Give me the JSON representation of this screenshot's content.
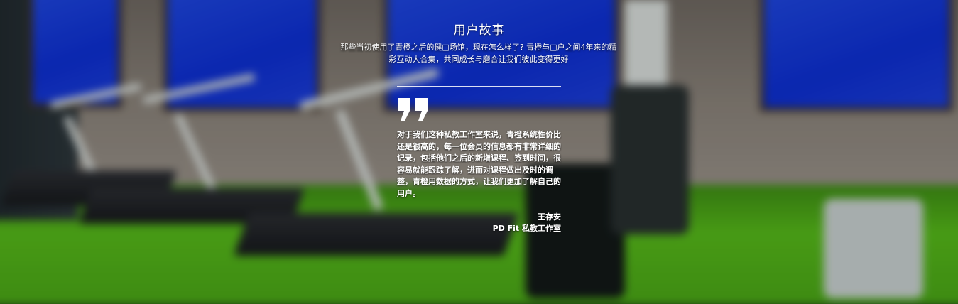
{
  "section": {
    "title": "用户故事",
    "subtitle": "那些当初使用了青橙之后的健□场馆，现在怎么样了? 青橙与□户之间4年来的精彩互动大合集，共同成长与磨合让我们彼此变得更好"
  },
  "testimonial": {
    "quote_icon": "quote-icon",
    "text": "对于我们这种私教工作室来说，青橙系统性价比还是很高的，每一位会员的信息都有非常详细的记录，包括他们之后的新增课程、签到时间，很容易就能跟踪了解，进而对课程做出及时的调整，青橙用数据的方式，让我们更加了解自己的用户。",
    "author_name": "王存安",
    "author_org": "PD Fit 私教工作室"
  },
  "colors": {
    "text": "#ffffff",
    "rule": "#ffffff",
    "floor_green": "#55b814",
    "window_blue": "#1a3ad8"
  }
}
